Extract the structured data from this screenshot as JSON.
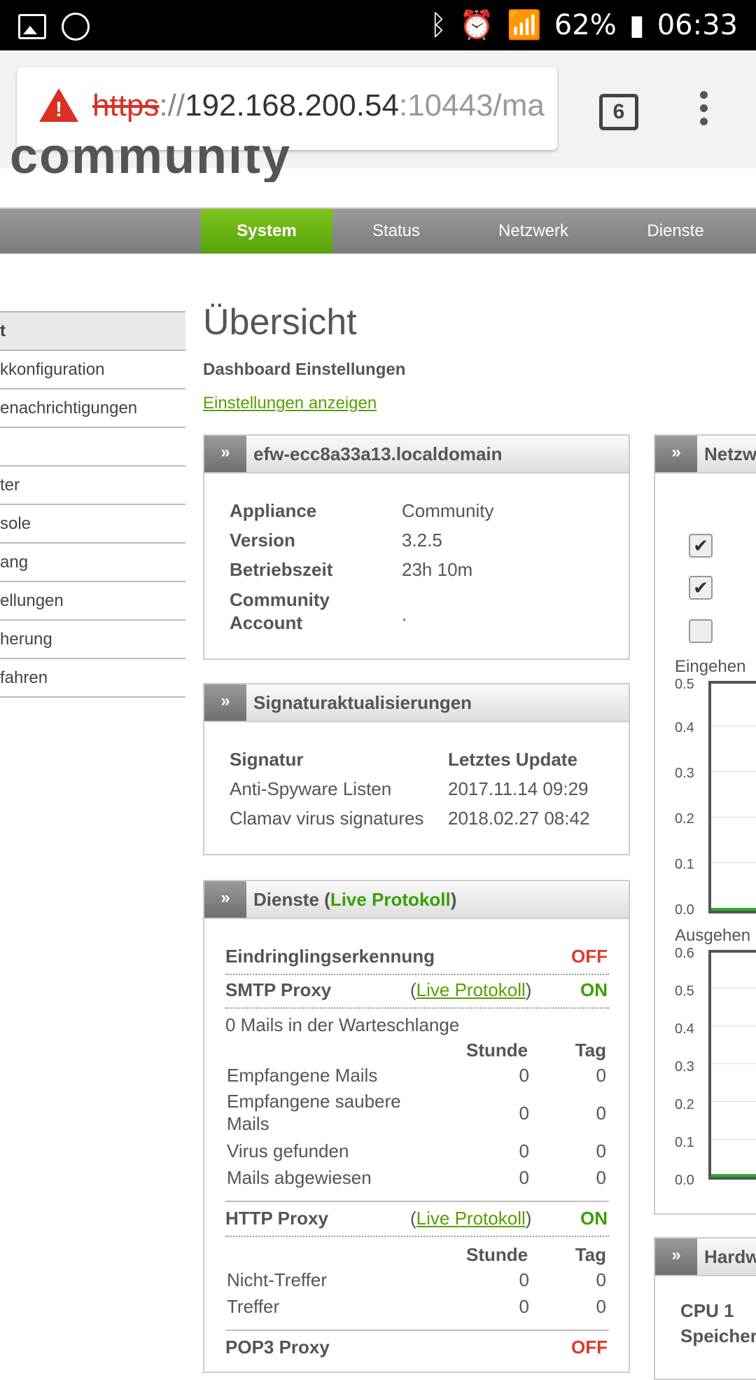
{
  "status_bar": {
    "battery": "62%",
    "time": "06:33"
  },
  "browser": {
    "url_scheme": "https",
    "url_sep": "://",
    "url_host": "192.168.200.54",
    "url_rest": ":10443/ma",
    "tab_count": "6"
  },
  "logo_text": "community",
  "nav": {
    "items": [
      "System",
      "Status",
      "Netzwerk",
      "Dienste"
    ],
    "active": "System"
  },
  "sidebar": {
    "items": [
      "t",
      "kkonfiguration",
      "enachrichtigungen",
      "",
      "ter",
      "sole",
      "ang",
      "ellungen",
      "herung",
      "fahren"
    ]
  },
  "main": {
    "title": "Übersicht",
    "dashboard_label": "Dashboard Einstellungen",
    "dashboard_link": "Einstellungen anzeigen"
  },
  "host_panel": {
    "title": "efw-ecc8a33a13.localdomain",
    "rows": [
      {
        "label": "Appliance",
        "value": "Community"
      },
      {
        "label": "Version",
        "value": "3.2.5"
      },
      {
        "label": "Betriebszeit",
        "value": "23h 10m"
      },
      {
        "label": "Community Account",
        "value": "."
      }
    ]
  },
  "sig_panel": {
    "title": "Signaturaktualisierungen",
    "col_signature": "Signatur",
    "col_update": "Letztes Update",
    "rows": [
      {
        "name": "Anti-Spyware Listen",
        "date": "2017.11.14 09:29"
      },
      {
        "name": "Clamav virus signatures",
        "date": "2018.02.27 08:42"
      }
    ]
  },
  "services_panel": {
    "title_prefix": "Dienste (",
    "title_link": "Live Protokoll",
    "title_suffix": ")",
    "ids": {
      "label": "Eindringlingserkennung",
      "state": "OFF"
    },
    "smtp": {
      "label": "SMTP Proxy",
      "link": "Live Protokoll",
      "state": "ON",
      "queue": "0 Mails in der Warteschlange",
      "col_hour": "Stunde",
      "col_day": "Tag",
      "rows": [
        {
          "name": "Empfangene Mails",
          "hour": "0",
          "day": "0"
        },
        {
          "name": "Empfangene saubere Mails",
          "hour": "0",
          "day": "0"
        },
        {
          "name": "Virus gefunden",
          "hour": "0",
          "day": "0"
        },
        {
          "name": "Mails abgewiesen",
          "hour": "0",
          "day": "0"
        }
      ]
    },
    "http": {
      "label": "HTTP Proxy",
      "link": "Live Protokoll",
      "state": "ON",
      "col_hour": "Stunde",
      "col_day": "Tag",
      "rows": [
        {
          "name": "Nicht-Treffer",
          "hour": "0",
          "day": "0"
        },
        {
          "name": "Treffer",
          "hour": "0",
          "day": "0"
        }
      ]
    },
    "pop3": {
      "label": "POP3 Proxy",
      "state": "OFF"
    }
  },
  "net_panel": {
    "title": "Netzw",
    "checkboxes": [
      true,
      true,
      false
    ],
    "incoming_label": "Eingehen",
    "incoming_ticks": [
      "0.5",
      "0.4",
      "0.3",
      "0.2",
      "0.1",
      "0.0"
    ],
    "outgoing_label": "Ausgehen",
    "outgoing_ticks": [
      "0.6",
      "0.5",
      "0.4",
      "0.3",
      "0.2",
      "0.1",
      "0.0"
    ]
  },
  "hw_panel": {
    "title": "Hardw",
    "cpu_label": "CPU 1",
    "mem_label": "Speicher"
  },
  "icons": {
    "arrow": "»",
    "check": "✔",
    "warning": "!"
  }
}
